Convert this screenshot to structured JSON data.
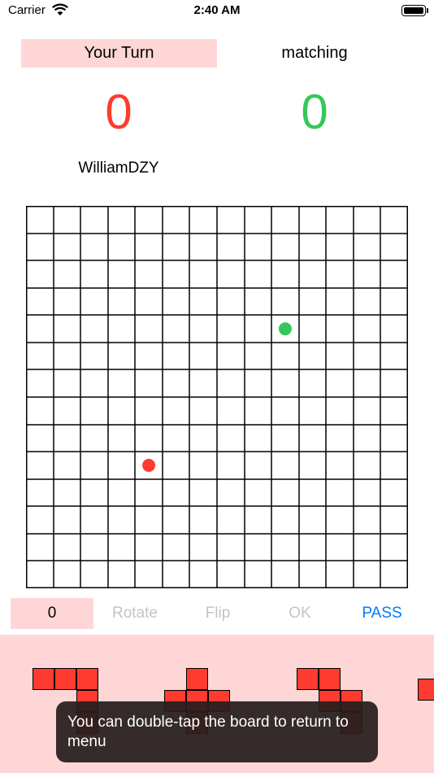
{
  "status_bar": {
    "carrier": "Carrier",
    "time": "2:40 AM",
    "icons": [
      "wifi-icon",
      "battery-icon"
    ]
  },
  "header": {
    "turn_label": "Your Turn",
    "opponent_status": "matching",
    "score_player": "0",
    "score_opponent": "0",
    "player_name": "WilliamDZY"
  },
  "board": {
    "rows": 14,
    "cols": 14,
    "markers": [
      {
        "row": 4,
        "col": 9,
        "color": "#34c759"
      },
      {
        "row": 9,
        "col": 4,
        "color": "#ff3b30"
      }
    ]
  },
  "controls": {
    "piece_count": "0",
    "rotate_label": "Rotate",
    "flip_label": "Flip",
    "ok_label": "OK",
    "pass_label": "PASS"
  },
  "tray": {
    "pieces": [
      {
        "cells": [
          [
            0,
            0
          ],
          [
            0,
            1
          ],
          [
            0,
            2
          ],
          [
            1,
            2
          ],
          [
            2,
            2
          ]
        ]
      },
      {
        "cells": [
          [
            0,
            1
          ],
          [
            1,
            0
          ],
          [
            1,
            1
          ],
          [
            1,
            2
          ],
          [
            2,
            1
          ]
        ]
      },
      {
        "cells": [
          [
            0,
            0
          ],
          [
            0,
            1
          ],
          [
            1,
            1
          ],
          [
            1,
            2
          ],
          [
            2,
            2
          ]
        ]
      },
      {
        "cells": [
          [
            1,
            0
          ]
        ]
      }
    ],
    "piece_color": "#ff3b30"
  },
  "toast": {
    "message": "You can double-tap the board to return to menu"
  },
  "colors": {
    "accent_pink": "#ffd6d6",
    "player_red": "#ff3b30",
    "opponent_green": "#34c759",
    "link_blue": "#007aff",
    "disabled_gray": "#c4c4c6"
  }
}
